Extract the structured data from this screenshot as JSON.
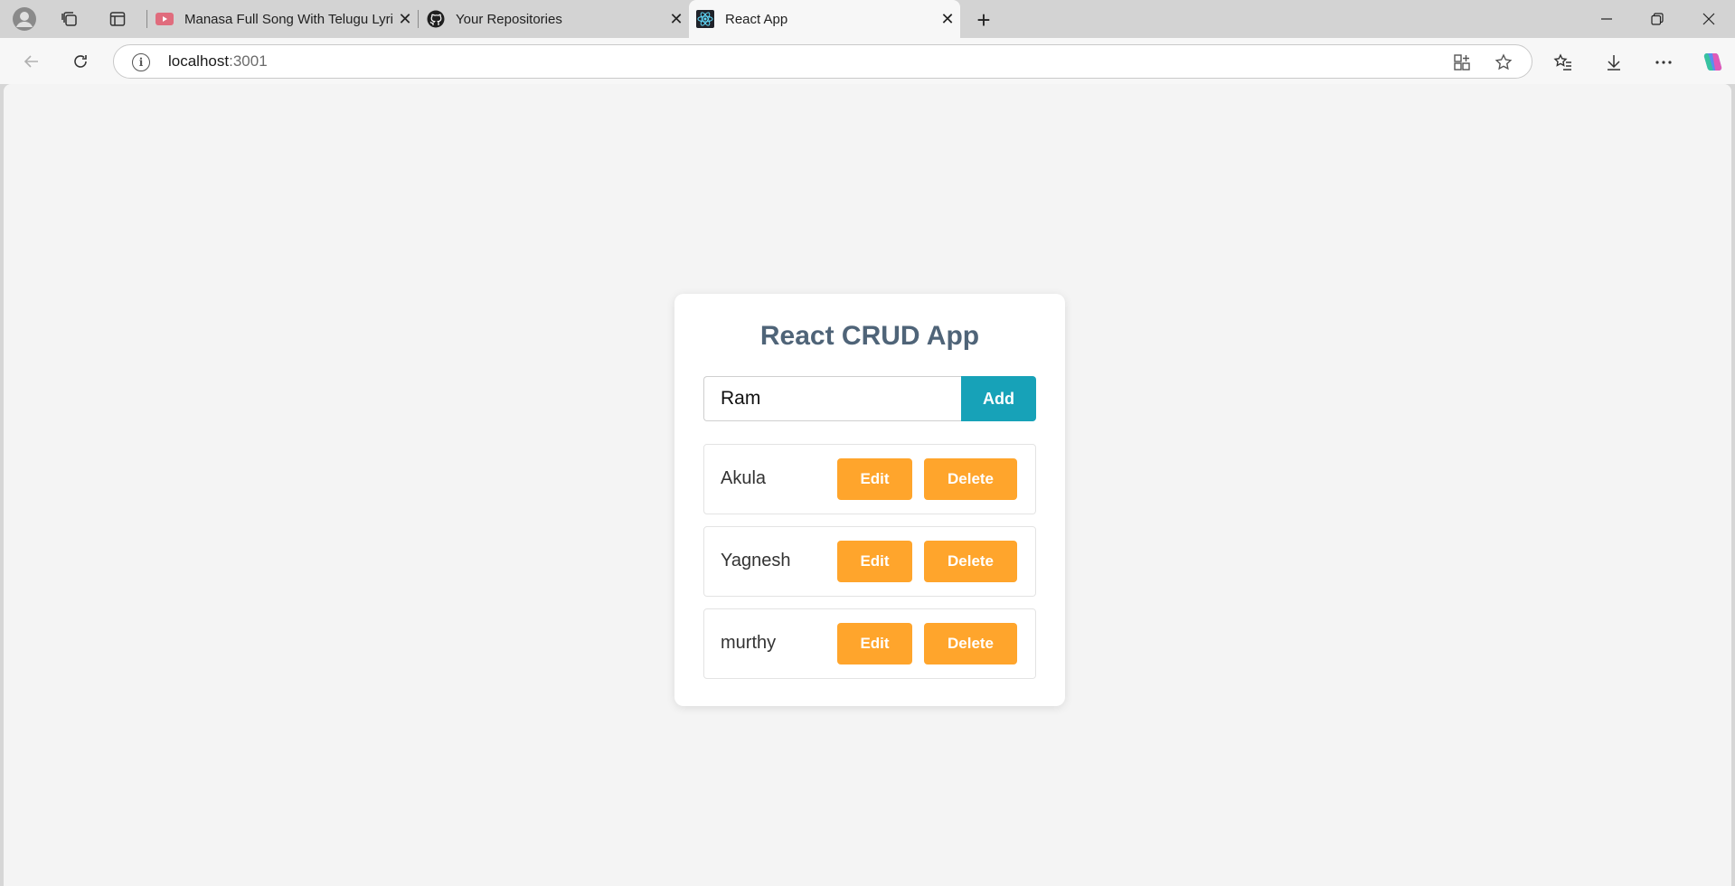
{
  "browser": {
    "tabs": [
      {
        "title": "Manasa Full Song With Telugu Lyrics",
        "icon": "youtube-icon",
        "active": false
      },
      {
        "title": "Your Repositories",
        "icon": "github-icon",
        "active": false
      },
      {
        "title": "React App",
        "icon": "react-icon",
        "active": true
      }
    ],
    "close_glyph": "✕",
    "newtab_glyph": "+",
    "address": {
      "host": "localhost",
      "port": ":3001"
    }
  },
  "app": {
    "title": "React CRUD App",
    "input_value": "Ram",
    "add_label": "Add",
    "items": [
      {
        "name": "Akula",
        "edit_label": "Edit",
        "delete_label": "Delete"
      },
      {
        "name": "Yagnesh",
        "edit_label": "Edit",
        "delete_label": "Delete"
      },
      {
        "name": "murthy",
        "edit_label": "Edit",
        "delete_label": "Delete"
      }
    ]
  },
  "colors": {
    "title": "#4f6478",
    "add_button": "#17a2b8",
    "action_buttons": "#ffa52c",
    "page_background": "#f4f4f4"
  }
}
